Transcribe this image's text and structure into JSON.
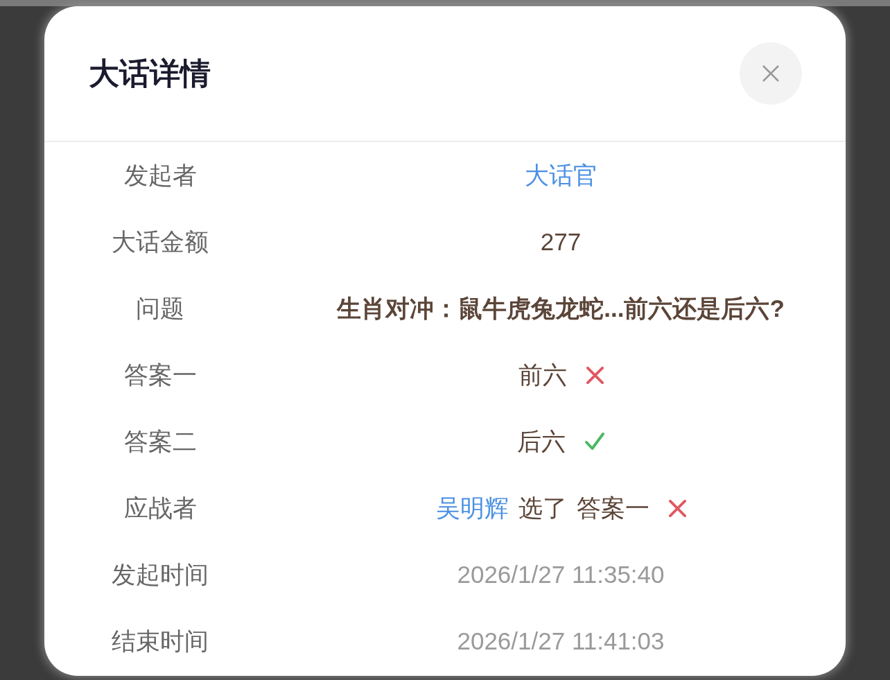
{
  "dialog": {
    "title": "大话详情",
    "rows": [
      {
        "label": "发起者",
        "kind": "link",
        "value": "大话官"
      },
      {
        "label": "大话金额",
        "kind": "text",
        "value": "277"
      },
      {
        "label": "问题",
        "kind": "question",
        "value": "生肖对冲：鼠牛虎兔龙蛇...前六还是后六?"
      },
      {
        "label": "答案一",
        "kind": "answer",
        "value": "前六",
        "correct": false
      },
      {
        "label": "答案二",
        "kind": "answer",
        "value": "后六",
        "correct": true
      },
      {
        "label": "应战者",
        "kind": "challenger",
        "name": "吴明辉",
        "action": "选了",
        "choice": "答案一",
        "correct": false
      },
      {
        "label": "发起时间",
        "kind": "time",
        "value": "2026/1/27 11:35:40"
      },
      {
        "label": "结束时间",
        "kind": "time",
        "value": "2026/1/27 11:41:03"
      }
    ]
  }
}
